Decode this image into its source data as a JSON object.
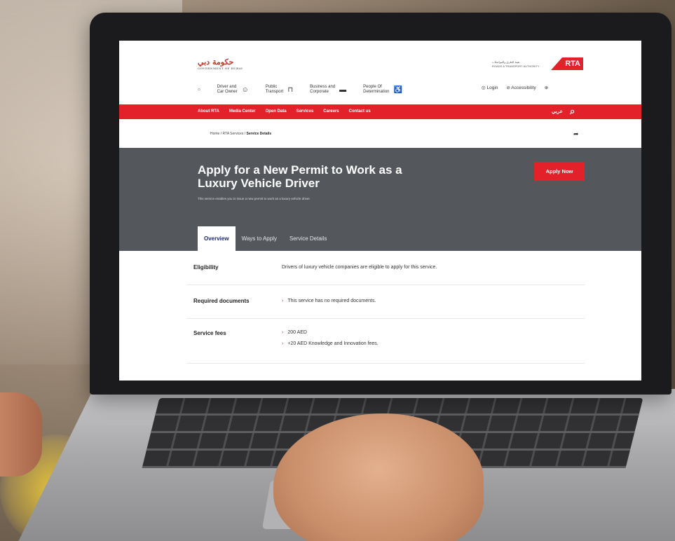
{
  "gov_logo": {
    "arabic": "حكومة دبي",
    "english": "GOVERNMENT OF DUBAI"
  },
  "rta": {
    "logo": "RTA",
    "subtitle_arabic": "هيئة الطرق والمواصلات",
    "subtitle_english": "ROADS & TRANSPORT AUTHORITY"
  },
  "nav": {
    "home_icon": "home-icon",
    "items": [
      {
        "label1": "Driver and",
        "label2": "Car Owner",
        "icon": "driver-icon"
      },
      {
        "label1": "Public",
        "label2": "Transport",
        "icon": "bus-icon"
      },
      {
        "label1": "Business and",
        "label2": "Corporate",
        "icon": "briefcase-icon"
      },
      {
        "label1": "People Of",
        "label2": "Determination",
        "icon": "wheelchair-icon"
      }
    ],
    "login": "Login",
    "accessibility": "Accessibility"
  },
  "redbar": {
    "links": [
      "About RTA",
      "Media Center",
      "Open Data",
      "Services",
      "Careers",
      "Contact us"
    ],
    "lang": "عربي"
  },
  "breadcrumb": {
    "home": "Home",
    "services": "RTA Services",
    "current": "Service Details"
  },
  "hero": {
    "title": "Apply for a New Permit to Work as a Luxury Vehicle Driver",
    "description": "This service enables you to issue a new permit to work as a luxury vehicle driver.",
    "apply_button": "Apply Now",
    "tabs": [
      "Overview",
      "Ways to Apply",
      "Service Details"
    ]
  },
  "details": {
    "eligibility_label": "Eligibility",
    "eligibility_value": "Drivers of luxury vehicle companies are eligible to apply for this service.",
    "documents_label": "Required documents",
    "documents_value": "This service has no required documents.",
    "fees_label": "Service fees",
    "fees": [
      "200 AED",
      "+20 AED Knowledge and Innovation fees."
    ]
  },
  "colors": {
    "accent": "#e2212a",
    "hero_bg": "#54575c",
    "tab_active_text": "#1f2a6e"
  }
}
